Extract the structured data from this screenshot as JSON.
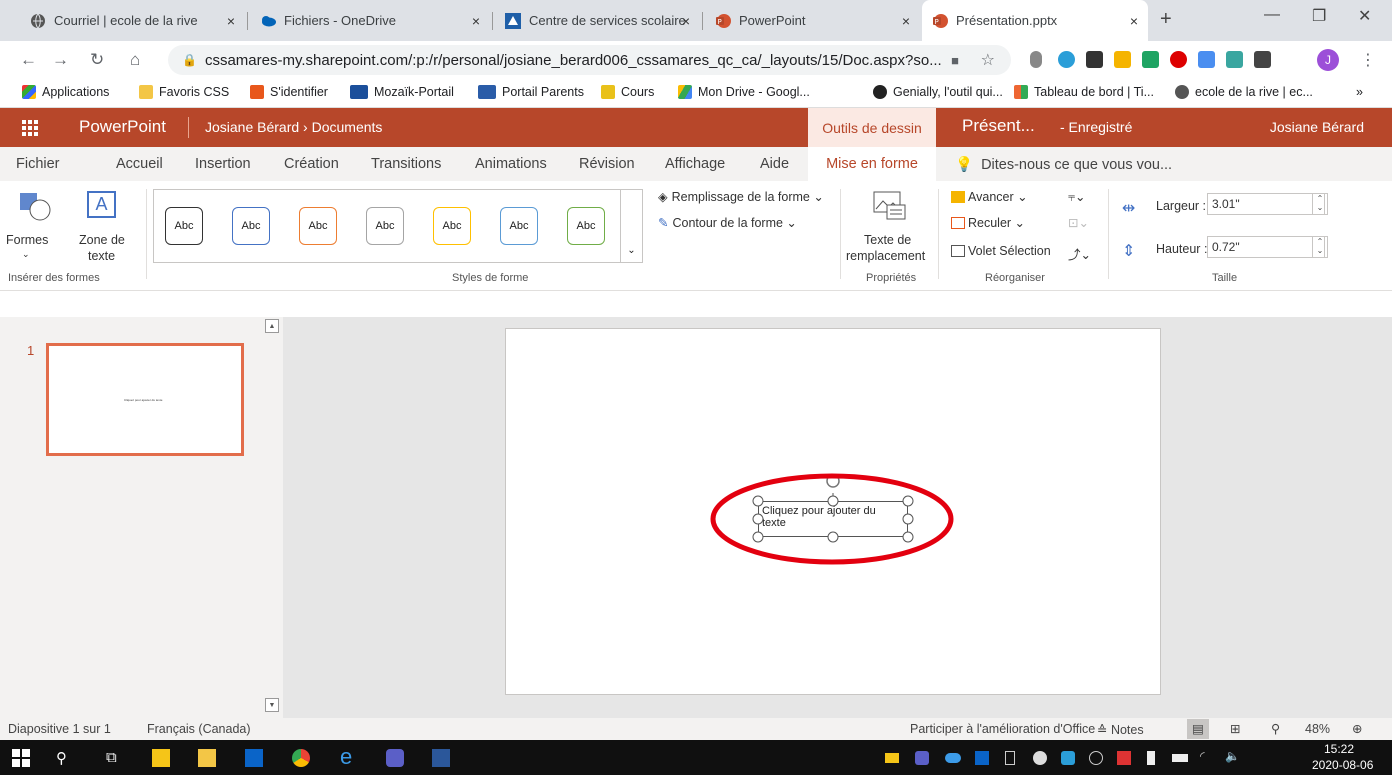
{
  "browser": {
    "tabs": [
      {
        "label": "Courriel | ecole de la rive",
        "icon": "globe-icon"
      },
      {
        "label": "Fichiers - OneDrive",
        "icon": "onedrive-icon"
      },
      {
        "label": "Centre de services scolaire",
        "icon": "css-logo-icon"
      },
      {
        "label": "PowerPoint",
        "icon": "powerpoint-icon"
      },
      {
        "label": "Présentation.pptx",
        "icon": "powerpoint-icon"
      }
    ],
    "close_glyph": "×",
    "new_tab_glyph": "+",
    "url": "cssamares-my.sharepoint.com/:p:/r/personal/josiane_berard006_cssamares_qc_ca/_layouts/15/Doc.aspx?so...",
    "profile_initial": "J",
    "bookmarks": [
      "Applications",
      "Favoris CSS",
      "S'identifier",
      "Mozaïk-Portail",
      "Portail Parents",
      "Cours",
      "Mon Drive - Googl...",
      "Genially, l'outil qui...",
      "Tableau de bord | Ti...",
      "ecole de la rive | ec..."
    ],
    "bookmarks_more": "»"
  },
  "office": {
    "app_name": "PowerPoint",
    "breadcrumb": "Josiane Bérard › Documents",
    "context_tab": "Outils de dessin",
    "doc_name": "Présent...",
    "save_state": "-  Enregistré",
    "user": "Josiane Bérard"
  },
  "ribbon_tabs": [
    "Fichier",
    "Accueil",
    "Insertion",
    "Création",
    "Transitions",
    "Animations",
    "Révision",
    "Affichage",
    "Aide"
  ],
  "active_tab": "Mise en forme",
  "tell_me": "Dites-nous ce que vous vou...",
  "ribbon": {
    "insert_shapes": {
      "formes": "Formes",
      "zone": "Zone de",
      "zone2": "texte",
      "label": "Insérer des formes"
    },
    "styles": {
      "abc": "Abc",
      "label": "Styles de forme",
      "colors": [
        "#333333",
        "#4472c4",
        "#ed7d31",
        "#a5a5a5",
        "#ffc000",
        "#5b9bd5",
        "#70ad47"
      ]
    },
    "fill": "Remplissage de la forme ⌄",
    "outline": "Contour de la forme ⌄",
    "alt_text": {
      "l1": "Texte de",
      "l2": "remplacement",
      "label": "Propriétés"
    },
    "arrange": {
      "forward": "Avancer ⌄",
      "backward": "Reculer ⌄",
      "pane": "Volet Sélection",
      "label": "Réorganiser"
    },
    "size": {
      "width_label": "Largeur :",
      "width": "3.01\"",
      "height_label": "Hauteur :",
      "height": "0.72\"",
      "label": "Taille"
    }
  },
  "slides": {
    "number": "1",
    "thumb_text": "Cliquez pour ajouter du texte"
  },
  "slide": {
    "placeholder": "Cliquez pour ajouter du texte"
  },
  "status": {
    "slide_of": "Diapositive 1 sur 1",
    "language": "Français (Canada)",
    "feedback": "Participer à l'amélioration d'Office",
    "notes": "≙ Notes",
    "zoom": "48%"
  },
  "taskbar": {
    "time": "15:22",
    "date": "2020-08-06"
  },
  "accent": "#b7472a",
  "highlight": "#e3000f"
}
